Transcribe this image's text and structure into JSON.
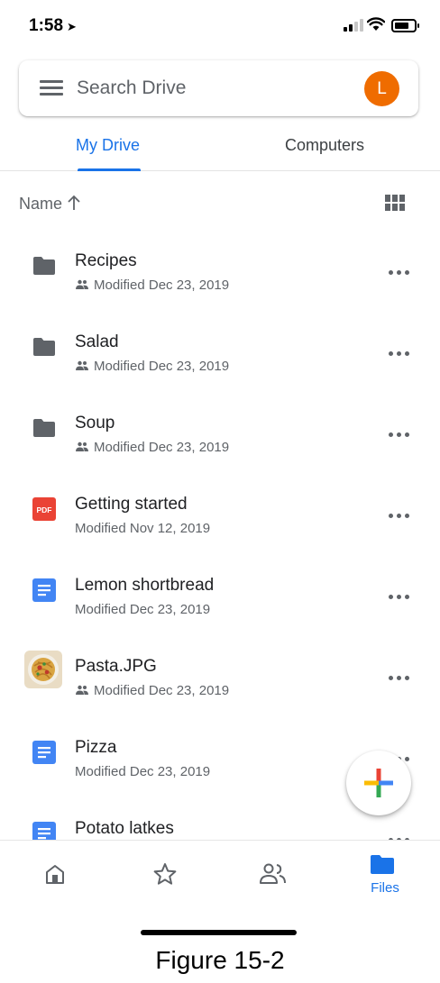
{
  "status_bar": {
    "time": "1:58",
    "location_arrow": "location-arrow-icon"
  },
  "search": {
    "placeholder": "Search Drive",
    "avatar_letter": "L",
    "avatar_color": "#ef6c00"
  },
  "tabs": [
    {
      "label": "My Drive",
      "active": true
    },
    {
      "label": "Computers",
      "active": false
    }
  ],
  "sort": {
    "label": "Name",
    "direction": "ascending"
  },
  "files": [
    {
      "name": "Recipes",
      "meta": "Modified Dec 23, 2019",
      "type": "folder",
      "shared": true
    },
    {
      "name": "Salad",
      "meta": "Modified Dec 23, 2019",
      "type": "folder",
      "shared": true
    },
    {
      "name": "Soup",
      "meta": "Modified Dec 23, 2019",
      "type": "folder",
      "shared": true
    },
    {
      "name": "Getting started",
      "meta": "Modified Nov 12, 2019",
      "type": "pdf",
      "shared": false
    },
    {
      "name": "Lemon shortbread",
      "meta": "Modified Dec 23, 2019",
      "type": "doc",
      "shared": false
    },
    {
      "name": "Pasta.JPG",
      "meta": "Modified Dec 23, 2019",
      "type": "image",
      "shared": true
    },
    {
      "name": "Pizza",
      "meta": "Modified Dec 23, 2019",
      "type": "doc",
      "shared": false
    },
    {
      "name": "Potato latkes",
      "meta": "",
      "type": "doc",
      "shared": false
    }
  ],
  "pdf_icon_text": "PDF",
  "bottom_nav": [
    {
      "icon": "home-icon",
      "label": ""
    },
    {
      "icon": "star-icon",
      "label": ""
    },
    {
      "icon": "shared-people-icon",
      "label": ""
    },
    {
      "icon": "folder-icon",
      "label": "Files",
      "active": true
    }
  ],
  "caption": "Figure 15-2",
  "colors": {
    "accent": "#1a73e8",
    "pdf_red": "#ea4335",
    "doc_blue": "#4285f4",
    "folder_grey": "#5f6368"
  }
}
